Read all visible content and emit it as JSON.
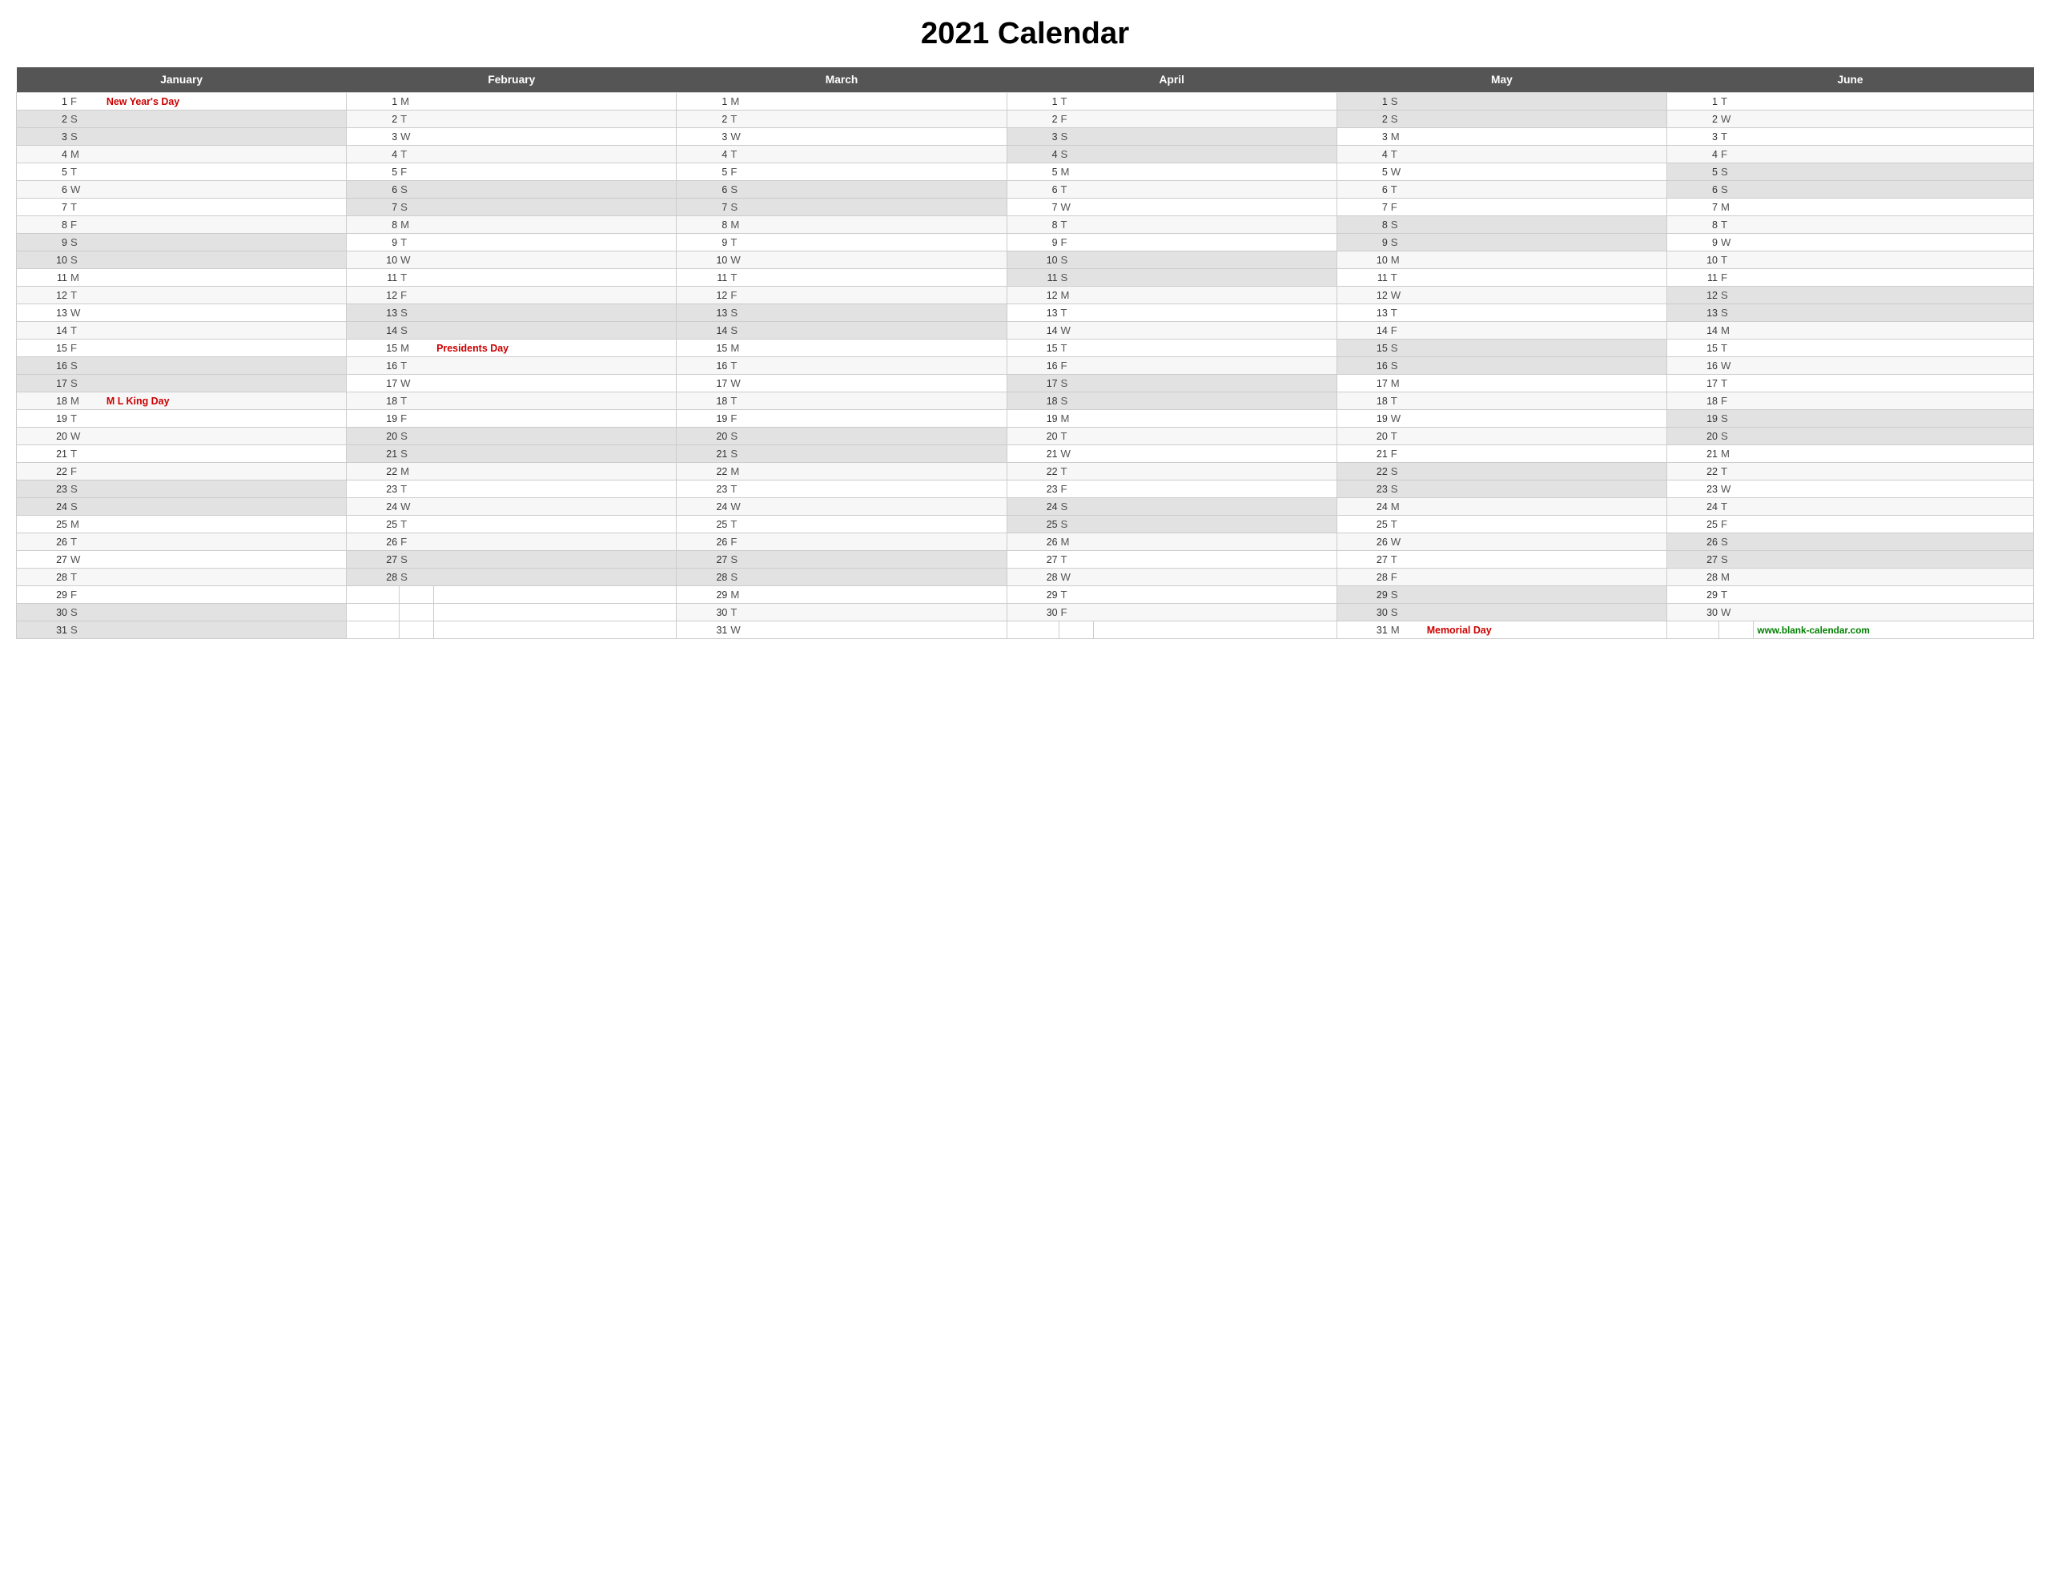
{
  "title": "2021 Calendar",
  "website": "www.blank-calendar.com",
  "months": [
    {
      "name": "January"
    },
    {
      "name": "February"
    },
    {
      "name": "March"
    },
    {
      "name": "April"
    },
    {
      "name": "May"
    },
    {
      "name": "June"
    }
  ],
  "days": {
    "jan": [
      {
        "d": 1,
        "w": "F",
        "h": "New Year's Day",
        "wknd": false
      },
      {
        "d": 2,
        "w": "S",
        "h": "",
        "wknd": true
      },
      {
        "d": 3,
        "w": "S",
        "h": "",
        "wknd": true
      },
      {
        "d": 4,
        "w": "M",
        "h": "",
        "wknd": false
      },
      {
        "d": 5,
        "w": "T",
        "h": "",
        "wknd": false
      },
      {
        "d": 6,
        "w": "W",
        "h": "",
        "wknd": false
      },
      {
        "d": 7,
        "w": "T",
        "h": "",
        "wknd": false
      },
      {
        "d": 8,
        "w": "F",
        "h": "",
        "wknd": false
      },
      {
        "d": 9,
        "w": "S",
        "h": "",
        "wknd": true
      },
      {
        "d": 10,
        "w": "S",
        "h": "",
        "wknd": true
      },
      {
        "d": 11,
        "w": "M",
        "h": "",
        "wknd": false
      },
      {
        "d": 12,
        "w": "T",
        "h": "",
        "wknd": false
      },
      {
        "d": 13,
        "w": "W",
        "h": "",
        "wknd": false
      },
      {
        "d": 14,
        "w": "T",
        "h": "",
        "wknd": false
      },
      {
        "d": 15,
        "w": "F",
        "h": "",
        "wknd": false
      },
      {
        "d": 16,
        "w": "S",
        "h": "",
        "wknd": true
      },
      {
        "d": 17,
        "w": "S",
        "h": "",
        "wknd": true
      },
      {
        "d": 18,
        "w": "M",
        "h": "M L King Day",
        "wknd": false
      },
      {
        "d": 19,
        "w": "T",
        "h": "",
        "wknd": false
      },
      {
        "d": 20,
        "w": "W",
        "h": "",
        "wknd": false
      },
      {
        "d": 21,
        "w": "T",
        "h": "",
        "wknd": false
      },
      {
        "d": 22,
        "w": "F",
        "h": "",
        "wknd": false
      },
      {
        "d": 23,
        "w": "S",
        "h": "",
        "wknd": true
      },
      {
        "d": 24,
        "w": "S",
        "h": "",
        "wknd": true
      },
      {
        "d": 25,
        "w": "M",
        "h": "",
        "wknd": false
      },
      {
        "d": 26,
        "w": "T",
        "h": "",
        "wknd": false
      },
      {
        "d": 27,
        "w": "W",
        "h": "",
        "wknd": false
      },
      {
        "d": 28,
        "w": "T",
        "h": "",
        "wknd": false
      },
      {
        "d": 29,
        "w": "F",
        "h": "",
        "wknd": false
      },
      {
        "d": 30,
        "w": "S",
        "h": "",
        "wknd": true
      },
      {
        "d": 31,
        "w": "S",
        "h": "",
        "wknd": true
      }
    ],
    "feb": [
      {
        "d": 1,
        "w": "M",
        "h": "",
        "wknd": false
      },
      {
        "d": 2,
        "w": "T",
        "h": "",
        "wknd": false
      },
      {
        "d": 3,
        "w": "W",
        "h": "",
        "wknd": false
      },
      {
        "d": 4,
        "w": "T",
        "h": "",
        "wknd": false
      },
      {
        "d": 5,
        "w": "F",
        "h": "",
        "wknd": false
      },
      {
        "d": 6,
        "w": "S",
        "h": "",
        "wknd": true
      },
      {
        "d": 7,
        "w": "S",
        "h": "",
        "wknd": true
      },
      {
        "d": 8,
        "w": "M",
        "h": "",
        "wknd": false
      },
      {
        "d": 9,
        "w": "T",
        "h": "",
        "wknd": false
      },
      {
        "d": 10,
        "w": "W",
        "h": "",
        "wknd": false
      },
      {
        "d": 11,
        "w": "T",
        "h": "",
        "wknd": false
      },
      {
        "d": 12,
        "w": "F",
        "h": "",
        "wknd": false
      },
      {
        "d": 13,
        "w": "S",
        "h": "",
        "wknd": true
      },
      {
        "d": 14,
        "w": "S",
        "h": "",
        "wknd": true
      },
      {
        "d": 15,
        "w": "M",
        "h": "Presidents Day",
        "wknd": false
      },
      {
        "d": 16,
        "w": "T",
        "h": "",
        "wknd": false
      },
      {
        "d": 17,
        "w": "W",
        "h": "",
        "wknd": false
      },
      {
        "d": 18,
        "w": "T",
        "h": "",
        "wknd": false
      },
      {
        "d": 19,
        "w": "F",
        "h": "",
        "wknd": false
      },
      {
        "d": 20,
        "w": "S",
        "h": "",
        "wknd": true
      },
      {
        "d": 21,
        "w": "S",
        "h": "",
        "wknd": true
      },
      {
        "d": 22,
        "w": "M",
        "h": "",
        "wknd": false
      },
      {
        "d": 23,
        "w": "T",
        "h": "",
        "wknd": false
      },
      {
        "d": 24,
        "w": "W",
        "h": "",
        "wknd": false
      },
      {
        "d": 25,
        "w": "T",
        "h": "",
        "wknd": false
      },
      {
        "d": 26,
        "w": "F",
        "h": "",
        "wknd": false
      },
      {
        "d": 27,
        "w": "S",
        "h": "",
        "wknd": true
      },
      {
        "d": 28,
        "w": "S",
        "h": "",
        "wknd": true
      }
    ],
    "mar": [
      {
        "d": 1,
        "w": "M",
        "h": "",
        "wknd": false
      },
      {
        "d": 2,
        "w": "T",
        "h": "",
        "wknd": false
      },
      {
        "d": 3,
        "w": "W",
        "h": "",
        "wknd": false
      },
      {
        "d": 4,
        "w": "T",
        "h": "",
        "wknd": false
      },
      {
        "d": 5,
        "w": "F",
        "h": "",
        "wknd": false
      },
      {
        "d": 6,
        "w": "S",
        "h": "",
        "wknd": true
      },
      {
        "d": 7,
        "w": "S",
        "h": "",
        "wknd": true
      },
      {
        "d": 8,
        "w": "M",
        "h": "",
        "wknd": false
      },
      {
        "d": 9,
        "w": "T",
        "h": "",
        "wknd": false
      },
      {
        "d": 10,
        "w": "W",
        "h": "",
        "wknd": false
      },
      {
        "d": 11,
        "w": "T",
        "h": "",
        "wknd": false
      },
      {
        "d": 12,
        "w": "F",
        "h": "",
        "wknd": false
      },
      {
        "d": 13,
        "w": "S",
        "h": "",
        "wknd": true
      },
      {
        "d": 14,
        "w": "S",
        "h": "",
        "wknd": true
      },
      {
        "d": 15,
        "w": "M",
        "h": "",
        "wknd": false
      },
      {
        "d": 16,
        "w": "T",
        "h": "",
        "wknd": false
      },
      {
        "d": 17,
        "w": "W",
        "h": "",
        "wknd": false
      },
      {
        "d": 18,
        "w": "T",
        "h": "",
        "wknd": false
      },
      {
        "d": 19,
        "w": "F",
        "h": "",
        "wknd": false
      },
      {
        "d": 20,
        "w": "S",
        "h": "",
        "wknd": true
      },
      {
        "d": 21,
        "w": "S",
        "h": "",
        "wknd": true
      },
      {
        "d": 22,
        "w": "M",
        "h": "",
        "wknd": false
      },
      {
        "d": 23,
        "w": "T",
        "h": "",
        "wknd": false
      },
      {
        "d": 24,
        "w": "W",
        "h": "",
        "wknd": false
      },
      {
        "d": 25,
        "w": "T",
        "h": "",
        "wknd": false
      },
      {
        "d": 26,
        "w": "F",
        "h": "",
        "wknd": false
      },
      {
        "d": 27,
        "w": "S",
        "h": "",
        "wknd": true
      },
      {
        "d": 28,
        "w": "S",
        "h": "",
        "wknd": true
      },
      {
        "d": 29,
        "w": "M",
        "h": "",
        "wknd": false
      },
      {
        "d": 30,
        "w": "T",
        "h": "",
        "wknd": false
      },
      {
        "d": 31,
        "w": "W",
        "h": "",
        "wknd": false
      }
    ],
    "apr": [
      {
        "d": 1,
        "w": "T",
        "h": "",
        "wknd": false
      },
      {
        "d": 2,
        "w": "F",
        "h": "",
        "wknd": false
      },
      {
        "d": 3,
        "w": "S",
        "h": "",
        "wknd": true
      },
      {
        "d": 4,
        "w": "S",
        "h": "",
        "wknd": true
      },
      {
        "d": 5,
        "w": "M",
        "h": "",
        "wknd": false
      },
      {
        "d": 6,
        "w": "T",
        "h": "",
        "wknd": false
      },
      {
        "d": 7,
        "w": "W",
        "h": "",
        "wknd": false
      },
      {
        "d": 8,
        "w": "T",
        "h": "",
        "wknd": false
      },
      {
        "d": 9,
        "w": "F",
        "h": "",
        "wknd": false
      },
      {
        "d": 10,
        "w": "S",
        "h": "",
        "wknd": true
      },
      {
        "d": 11,
        "w": "S",
        "h": "",
        "wknd": true
      },
      {
        "d": 12,
        "w": "M",
        "h": "",
        "wknd": false
      },
      {
        "d": 13,
        "w": "T",
        "h": "",
        "wknd": false
      },
      {
        "d": 14,
        "w": "W",
        "h": "",
        "wknd": false
      },
      {
        "d": 15,
        "w": "T",
        "h": "",
        "wknd": false
      },
      {
        "d": 16,
        "w": "F",
        "h": "",
        "wknd": false
      },
      {
        "d": 17,
        "w": "S",
        "h": "",
        "wknd": true
      },
      {
        "d": 18,
        "w": "S",
        "h": "",
        "wknd": true
      },
      {
        "d": 19,
        "w": "M",
        "h": "",
        "wknd": false
      },
      {
        "d": 20,
        "w": "T",
        "h": "",
        "wknd": false
      },
      {
        "d": 21,
        "w": "W",
        "h": "",
        "wknd": false
      },
      {
        "d": 22,
        "w": "T",
        "h": "",
        "wknd": false
      },
      {
        "d": 23,
        "w": "F",
        "h": "",
        "wknd": false
      },
      {
        "d": 24,
        "w": "S",
        "h": "",
        "wknd": true
      },
      {
        "d": 25,
        "w": "S",
        "h": "",
        "wknd": true
      },
      {
        "d": 26,
        "w": "M",
        "h": "",
        "wknd": false
      },
      {
        "d": 27,
        "w": "T",
        "h": "",
        "wknd": false
      },
      {
        "d": 28,
        "w": "W",
        "h": "",
        "wknd": false
      },
      {
        "d": 29,
        "w": "T",
        "h": "",
        "wknd": false
      },
      {
        "d": 30,
        "w": "F",
        "h": "",
        "wknd": false
      }
    ],
    "may": [
      {
        "d": 1,
        "w": "S",
        "h": "",
        "wknd": true
      },
      {
        "d": 2,
        "w": "S",
        "h": "",
        "wknd": true
      },
      {
        "d": 3,
        "w": "M",
        "h": "",
        "wknd": false
      },
      {
        "d": 4,
        "w": "T",
        "h": "",
        "wknd": false
      },
      {
        "d": 5,
        "w": "W",
        "h": "",
        "wknd": false
      },
      {
        "d": 6,
        "w": "T",
        "h": "",
        "wknd": false
      },
      {
        "d": 7,
        "w": "F",
        "h": "",
        "wknd": false
      },
      {
        "d": 8,
        "w": "S",
        "h": "",
        "wknd": true
      },
      {
        "d": 9,
        "w": "S",
        "h": "",
        "wknd": true
      },
      {
        "d": 10,
        "w": "M",
        "h": "",
        "wknd": false
      },
      {
        "d": 11,
        "w": "T",
        "h": "",
        "wknd": false
      },
      {
        "d": 12,
        "w": "W",
        "h": "",
        "wknd": false
      },
      {
        "d": 13,
        "w": "T",
        "h": "",
        "wknd": false
      },
      {
        "d": 14,
        "w": "F",
        "h": "",
        "wknd": false
      },
      {
        "d": 15,
        "w": "S",
        "h": "",
        "wknd": true
      },
      {
        "d": 16,
        "w": "S",
        "h": "",
        "wknd": true
      },
      {
        "d": 17,
        "w": "M",
        "h": "",
        "wknd": false
      },
      {
        "d": 18,
        "w": "T",
        "h": "",
        "wknd": false
      },
      {
        "d": 19,
        "w": "W",
        "h": "",
        "wknd": false
      },
      {
        "d": 20,
        "w": "T",
        "h": "",
        "wknd": false
      },
      {
        "d": 21,
        "w": "F",
        "h": "",
        "wknd": false
      },
      {
        "d": 22,
        "w": "S",
        "h": "",
        "wknd": true
      },
      {
        "d": 23,
        "w": "S",
        "h": "",
        "wknd": true
      },
      {
        "d": 24,
        "w": "M",
        "h": "",
        "wknd": false
      },
      {
        "d": 25,
        "w": "T",
        "h": "",
        "wknd": false
      },
      {
        "d": 26,
        "w": "W",
        "h": "",
        "wknd": false
      },
      {
        "d": 27,
        "w": "T",
        "h": "",
        "wknd": false
      },
      {
        "d": 28,
        "w": "F",
        "h": "",
        "wknd": false
      },
      {
        "d": 29,
        "w": "S",
        "h": "",
        "wknd": true
      },
      {
        "d": 30,
        "w": "S",
        "h": "",
        "wknd": true
      },
      {
        "d": 31,
        "w": "M",
        "h": "Memorial Day",
        "wknd": false
      }
    ],
    "jun": [
      {
        "d": 1,
        "w": "T",
        "h": "",
        "wknd": false
      },
      {
        "d": 2,
        "w": "W",
        "h": "",
        "wknd": false
      },
      {
        "d": 3,
        "w": "T",
        "h": "",
        "wknd": false
      },
      {
        "d": 4,
        "w": "F",
        "h": "",
        "wknd": false
      },
      {
        "d": 5,
        "w": "S",
        "h": "",
        "wknd": true
      },
      {
        "d": 6,
        "w": "S",
        "h": "",
        "wknd": true
      },
      {
        "d": 7,
        "w": "M",
        "h": "",
        "wknd": false
      },
      {
        "d": 8,
        "w": "T",
        "h": "",
        "wknd": false
      },
      {
        "d": 9,
        "w": "W",
        "h": "",
        "wknd": false
      },
      {
        "d": 10,
        "w": "T",
        "h": "",
        "wknd": false
      },
      {
        "d": 11,
        "w": "F",
        "h": "",
        "wknd": false
      },
      {
        "d": 12,
        "w": "S",
        "h": "",
        "wknd": true
      },
      {
        "d": 13,
        "w": "S",
        "h": "",
        "wknd": true
      },
      {
        "d": 14,
        "w": "M",
        "h": "",
        "wknd": false
      },
      {
        "d": 15,
        "w": "T",
        "h": "",
        "wknd": false
      },
      {
        "d": 16,
        "w": "W",
        "h": "",
        "wknd": false
      },
      {
        "d": 17,
        "w": "T",
        "h": "",
        "wknd": false
      },
      {
        "d": 18,
        "w": "F",
        "h": "",
        "wknd": false
      },
      {
        "d": 19,
        "w": "S",
        "h": "",
        "wknd": true
      },
      {
        "d": 20,
        "w": "S",
        "h": "",
        "wknd": true
      },
      {
        "d": 21,
        "w": "M",
        "h": "",
        "wknd": false
      },
      {
        "d": 22,
        "w": "T",
        "h": "",
        "wknd": false
      },
      {
        "d": 23,
        "w": "W",
        "h": "",
        "wknd": false
      },
      {
        "d": 24,
        "w": "T",
        "h": "",
        "wknd": false
      },
      {
        "d": 25,
        "w": "F",
        "h": "",
        "wknd": false
      },
      {
        "d": 26,
        "w": "S",
        "h": "",
        "wknd": true
      },
      {
        "d": 27,
        "w": "S",
        "h": "",
        "wknd": true
      },
      {
        "d": 28,
        "w": "M",
        "h": "",
        "wknd": false
      },
      {
        "d": 29,
        "w": "T",
        "h": "",
        "wknd": false
      },
      {
        "d": 30,
        "w": "W",
        "h": "",
        "wknd": false
      }
    ]
  }
}
